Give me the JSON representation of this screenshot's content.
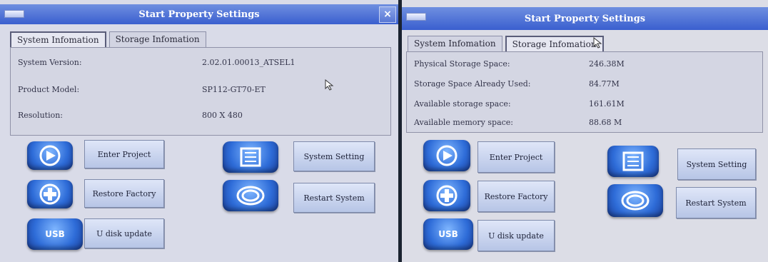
{
  "left_window": {
    "title": "Start Property Settings",
    "tabs": [
      "System Infomation",
      "Storage Infomation"
    ],
    "active_tab": 0,
    "rows": [
      {
        "label": "System Version:",
        "value": "2.02.01.00013_ATSEL1"
      },
      {
        "label": "Product Model:",
        "value": "SP112-GT70-ET"
      },
      {
        "label": "Resolution:",
        "value": "800 X 480"
      }
    ],
    "buttons": {
      "enter_project": "Enter Project",
      "restore_factory": "Restore Factory",
      "u_disk_update": "U disk update",
      "system_setting": "System Setting",
      "restart_system": "Restart System"
    },
    "close_glyph": "×",
    "usb_label": "USB"
  },
  "right_window": {
    "title": "Start Property Settings",
    "tabs": [
      "System Infomation",
      "Storage Infomation"
    ],
    "active_tab": 1,
    "rows": [
      {
        "label": "Physical Storage Space:",
        "value": "246.38M"
      },
      {
        "label": "Storage Space Already Used:",
        "value": "84.77M"
      },
      {
        "label": "Available storage space:",
        "value": "161.61M"
      },
      {
        "label": "Available memory space:",
        "value": "88.68 M"
      }
    ],
    "buttons": {
      "enter_project": "Enter Project",
      "restore_factory": "Restore Factory",
      "u_disk_update": "U disk update",
      "system_setting": "System Setting",
      "restart_system": "Restart System"
    },
    "usb_label": "USB"
  },
  "colors": {
    "titlebar": "#3a5fcf",
    "panel_bg": "#d9dbe8",
    "icon_blue": "#2e6cd8"
  }
}
